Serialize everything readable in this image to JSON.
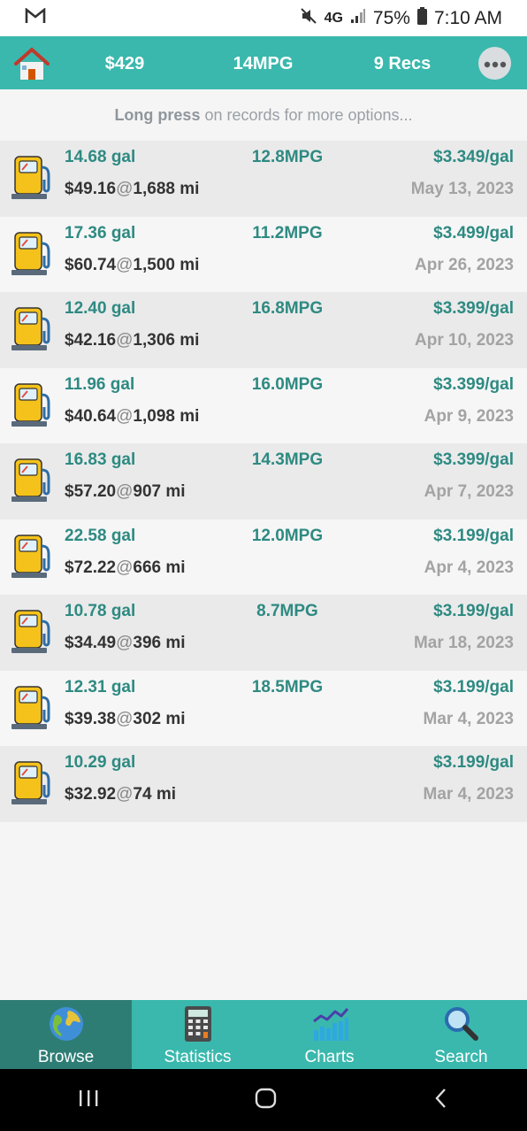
{
  "status_bar": {
    "battery": "75%",
    "time": "7:10 AM",
    "network": "4G"
  },
  "header": {
    "total_cost": "$429",
    "avg_mpg": "14MPG",
    "record_count": "9 Recs"
  },
  "hint": {
    "bold": "Long press",
    "rest": " on records for more options..."
  },
  "records": [
    {
      "gallons": "14.68 gal",
      "mpg": "12.8MPG",
      "price": "$3.349/gal",
      "cost": "$49.16",
      "at": "@",
      "odometer": "1,688 mi",
      "date": "May 13, 2023"
    },
    {
      "gallons": "17.36 gal",
      "mpg": "11.2MPG",
      "price": "$3.499/gal",
      "cost": "$60.74",
      "at": "@",
      "odometer": "1,500 mi",
      "date": "Apr 26, 2023"
    },
    {
      "gallons": "12.40 gal",
      "mpg": "16.8MPG",
      "price": "$3.399/gal",
      "cost": "$42.16",
      "at": "@",
      "odometer": "1,306 mi",
      "date": "Apr 10, 2023"
    },
    {
      "gallons": "11.96 gal",
      "mpg": "16.0MPG",
      "price": "$3.399/gal",
      "cost": "$40.64",
      "at": "@",
      "odometer": "1,098 mi",
      "date": "Apr 9, 2023"
    },
    {
      "gallons": "16.83 gal",
      "mpg": "14.3MPG",
      "price": "$3.399/gal",
      "cost": "$57.20",
      "at": "@",
      "odometer": "907 mi",
      "date": "Apr 7, 2023"
    },
    {
      "gallons": "22.58 gal",
      "mpg": "12.0MPG",
      "price": "$3.199/gal",
      "cost": "$72.22",
      "at": "@",
      "odometer": "666 mi",
      "date": "Apr 4, 2023"
    },
    {
      "gallons": "10.78 gal",
      "mpg": "8.7MPG",
      "price": "$3.199/gal",
      "cost": "$34.49",
      "at": "@",
      "odometer": "396 mi",
      "date": "Mar 18, 2023"
    },
    {
      "gallons": "12.31 gal",
      "mpg": "18.5MPG",
      "price": "$3.199/gal",
      "cost": "$39.38",
      "at": "@",
      "odometer": "302 mi",
      "date": "Mar 4, 2023"
    },
    {
      "gallons": "10.29 gal",
      "mpg": "",
      "price": "$3.199/gal",
      "cost": "$32.92",
      "at": "@",
      "odometer": "74 mi",
      "date": "Mar 4, 2023"
    }
  ],
  "bottom_nav": [
    {
      "label": "Browse",
      "icon": "globe-icon",
      "active": true
    },
    {
      "label": "Statistics",
      "icon": "calculator-icon",
      "active": false
    },
    {
      "label": "Charts",
      "icon": "chart-icon",
      "active": false
    },
    {
      "label": "Search",
      "icon": "magnifier-icon",
      "active": false
    }
  ],
  "colors": {
    "accent": "#3ab8ad",
    "accent_dark": "#2e7d75",
    "teal_text": "#2e8a82"
  }
}
